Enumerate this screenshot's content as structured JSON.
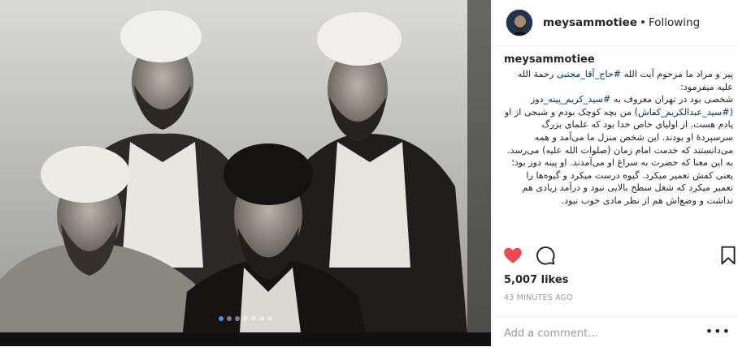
{
  "photo": {
    "description_icon": "portrait-photo",
    "carousel_count": 7,
    "active_index": 0
  },
  "header": {
    "username": "meysammotiee",
    "separator": "•",
    "follow_status": "Following"
  },
  "caption": {
    "username": "meysammotiee",
    "line1_pre": "پیر و مراد ما مرحوم آیت الله ",
    "line1_tag": "#حاج_آقا_مجتبی",
    "line1_post": " رحمة الله علیه میفرمود:",
    "line2_pre": "شخصی بود در تهران معروف به ",
    "line2_tag": "#سید_کریم_پینه_دوز",
    "line3_tag": "(#سید_عبدالکریم_کفاش)",
    "line3_post": " من بچه کوچک بودم و شبحی از او یادم هست. از اولیای خاص خدا بود که علمای بزرگ سرسپردهٔ او بودند. این شخص منزل ما می‌آمد و همه می‌دانستند که خدمت امام زمان (صلوات الله علیه) می‌رسد. به این معنا که حضرت به سراغ او می‌آمدند. او پینه دوز بود؛ یعنی کفش تعمیر میکرد. گیوه درست میکرد و گیوه‌ها را تعمیر میکرد که شغل سطح بالایی نبود و درآمد زیادی هم نداشت و وضع‌اش هم از نظر مادی خوب نبود."
  },
  "actions": {
    "like_icon": "heart-filled-icon",
    "comment_icon": "comment-bubble-icon",
    "save_icon": "bookmark-icon",
    "like_color": "#ed4956"
  },
  "likes": "5,007 likes",
  "timestamp": "43 MINUTES AGO",
  "comment": {
    "placeholder": "Add a comment…",
    "more_label": "•••"
  }
}
